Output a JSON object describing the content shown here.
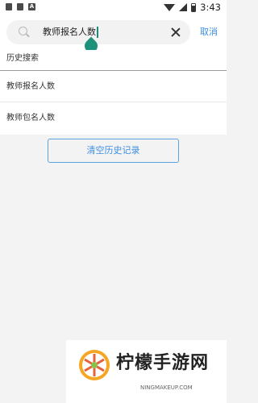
{
  "status_bar": {
    "left_icons": [
      "notification-icon",
      "notification-icon",
      "app-a-icon"
    ],
    "right_icons": [
      "wifi-icon",
      "signal-icon",
      "battery-icon"
    ],
    "time": "3:43"
  },
  "search": {
    "value": "教师报名人数",
    "icon": "search-icon",
    "clear_icon": "close-icon",
    "cancel_label": "取消",
    "cursor_color": "#1d9179"
  },
  "history": {
    "title": "历史搜索",
    "items": [
      {
        "label": "教师报名人数"
      },
      {
        "label": "教师包名人数"
      }
    ],
    "clear_button_label": "清空历史记录"
  },
  "watermark": {
    "title": "柠檬手游网",
    "subtitle": "NINGMAKEUP.COM"
  },
  "colors": {
    "accent": "#3c8fe0",
    "background": "#f3f3f3",
    "handle": "#1d9179"
  }
}
